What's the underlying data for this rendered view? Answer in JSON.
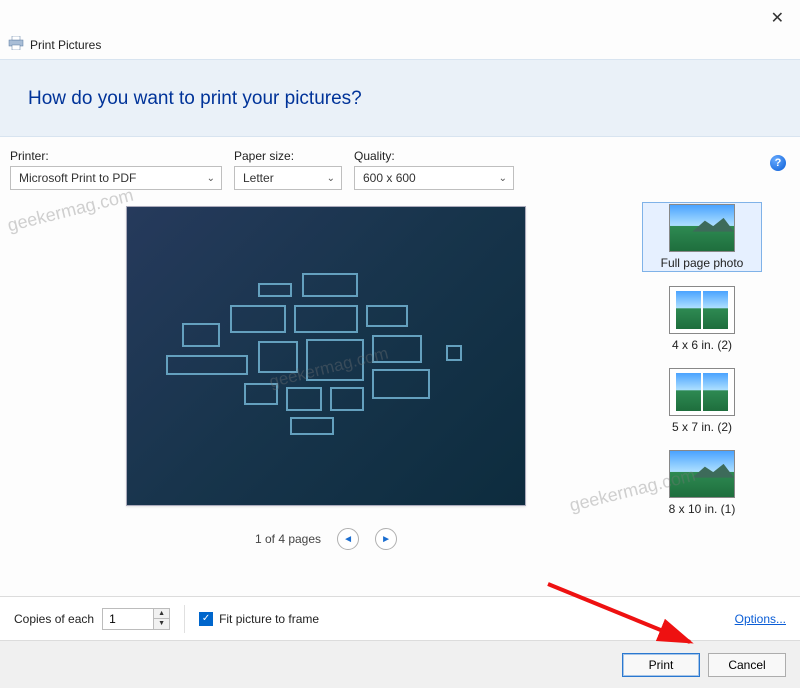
{
  "window": {
    "title": "Print Pictures"
  },
  "header": {
    "heading": "How do you want to print your pictures?"
  },
  "fields": {
    "printer_label": "Printer:",
    "paper_label": "Paper size:",
    "quality_label": "Quality:",
    "printer_value": "Microsoft Print to PDF",
    "paper_value": "Letter",
    "quality_value": "600 x 600"
  },
  "pager": {
    "status": "1 of 4 pages"
  },
  "layouts": [
    {
      "label": "Full page photo",
      "style": "full",
      "selected": true
    },
    {
      "label": "4 x 6 in. (2)",
      "style": "two",
      "selected": false
    },
    {
      "label": "5 x 7 in. (2)",
      "style": "two",
      "selected": false
    },
    {
      "label": "8 x 10 in. (1)",
      "style": "full",
      "selected": false
    }
  ],
  "bottom": {
    "copies_label": "Copies of each",
    "copies_value": "1",
    "fit_label": "Fit picture to frame",
    "fit_checked": true,
    "options_label": "Options..."
  },
  "buttons": {
    "print": "Print",
    "cancel": "Cancel"
  },
  "watermark": "geekermag.com"
}
